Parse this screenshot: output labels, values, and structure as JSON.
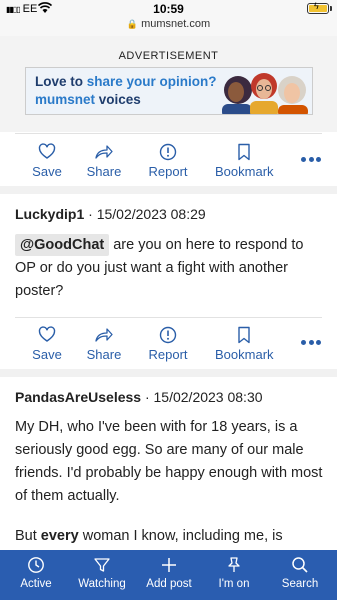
{
  "status_bar": {
    "carrier": "EE",
    "time": "10:59"
  },
  "browser": {
    "url": "mumsnet.com"
  },
  "ad": {
    "label": "ADVERTISEMENT",
    "line1_prefix": "Love to ",
    "line1_highlight": "share your opinion?",
    "line2_brand": "mumsnet",
    "line2_suffix": " voices"
  },
  "actions": {
    "save": "Save",
    "share": "Share",
    "report": "Report",
    "bookmark": "Bookmark"
  },
  "posts": [
    {
      "username": "Luckydip1",
      "timestamp": " · 15/02/2023 08:29",
      "mention": "@GoodChat",
      "body_after_mention": " are you on here to respond to OP or do you just want a fight with another poster?"
    },
    {
      "username": "PandasAreUseless",
      "timestamp": " · 15/02/2023 08:30",
      "paragraph1": "My DH, who I've been with for 18 years, is a seriously good egg. So are many of our male friends. I'd probably be happy enough with most of them actually.",
      "paragraph2_prefix": "But ",
      "paragraph2_bold": "every",
      "paragraph2_suffix": " woman I know, including me, is"
    }
  ],
  "bottom_nav": {
    "active": "Active",
    "watching": "Watching",
    "add_post": "Add post",
    "im_on": "I'm on",
    "search": "Search"
  },
  "colors": {
    "accent": "#2a5ea8",
    "nav_bg": "#2a5db0",
    "battery": "#f2c230"
  }
}
